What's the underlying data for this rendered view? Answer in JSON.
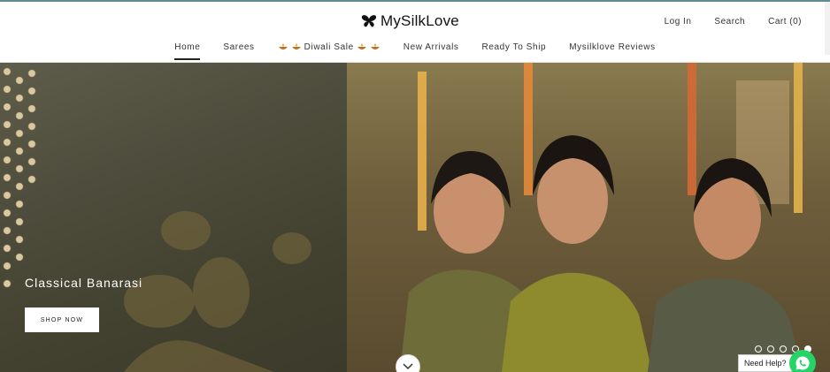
{
  "header": {
    "logo_text": "MySilkLove",
    "actions": {
      "login": "Log In",
      "search": "Search",
      "cart": "Cart (0)"
    }
  },
  "nav": {
    "items": [
      {
        "label": "Home",
        "active": true
      },
      {
        "label": "Sarees"
      },
      {
        "label": "Diwali Sale"
      },
      {
        "label": "New Arrivals"
      },
      {
        "label": "Ready To Ship"
      },
      {
        "label": "Mysilklove Reviews"
      }
    ]
  },
  "hero": {
    "title": "Classical Banarasi",
    "button_label": "SHOP NOW",
    "slide_count": 5,
    "active_slide": 5
  },
  "help": {
    "label": "Need Help?"
  },
  "icons": {
    "logo": "butterfly-icon",
    "diya": "diya-icon",
    "scroll_down": "chevron-down-icon",
    "whatsapp": "whatsapp-icon"
  },
  "colors": {
    "whatsapp": "#25d366",
    "topbar": "#5f8f92"
  }
}
